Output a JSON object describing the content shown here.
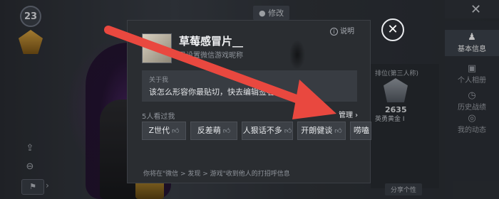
{
  "hud": {
    "level": "23",
    "top_chip": "● 修改",
    "bottom_left_label": "⚑",
    "bottom_right_label": "分享个性"
  },
  "right_column": {
    "items": [
      {
        "label": "基本信息",
        "icon": "person-icon",
        "active": true
      },
      {
        "label": "个人相册",
        "icon": "photo-icon",
        "active": false
      },
      {
        "label": "历史战绩",
        "icon": "history-icon",
        "active": false
      },
      {
        "label": "我的动态",
        "icon": "feed-icon",
        "active": false
      }
    ]
  },
  "stats": {
    "mode": "排位(第三人称)",
    "rating": "2635",
    "tier": "英勇黄金 I"
  },
  "modal": {
    "nickname": "草莓感冒片__",
    "nick_hint": "已设置微信游戏昵称",
    "help_label": "说明",
    "about_label": "关于我",
    "about_text": "该怎么形容你最贴切，快去编辑签名",
    "like_count": "5人看过我",
    "manage_label": "管理 ›",
    "tags": [
      "Z世代",
      "反差萌",
      "人狠话不多",
      "开朗健谈",
      "唠嗑达"
    ],
    "footer_hint": "你将在\"微信 > 发现 > 游戏\"收到他人的打招呼信息"
  },
  "annotation": {
    "arrow_color": "#e9483f"
  }
}
